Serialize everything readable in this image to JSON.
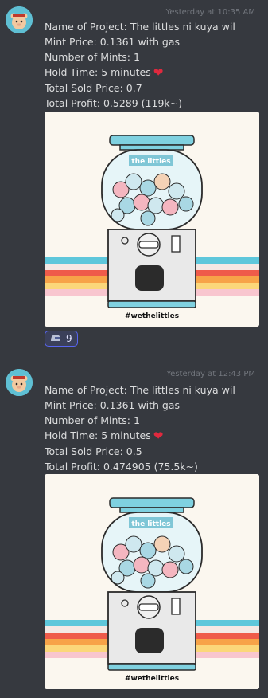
{
  "colors": {
    "background": "#36393f",
    "text": "#dcddde",
    "timestamp": "#72767d",
    "heart": "#e0293e",
    "reaction_border": "#5865f2"
  },
  "messages": [
    {
      "timestamp": "Yesterday at 10:35 AM",
      "lines": {
        "project": "Name of Project: The littles ni kuya wil",
        "mint_price": "Mint Price: 0.1361 with gas",
        "mints": "Number of Mints: 1",
        "hold_time": "Hold Time: 5 minutes",
        "sold_price": "Total Sold Price: 0.7",
        "profit": "Total Profit: 0.5289 (119k~)"
      },
      "image": {
        "title": "the littles",
        "caption": "#wethelittles"
      },
      "reaction": {
        "icon": "helmet-emoji",
        "count": "9"
      }
    },
    {
      "timestamp": "Yesterday at 12:43 PM",
      "lines": {
        "project": "Name of Project: The littles ni kuya wil",
        "mint_price": "Mint Price: 0.1361 with gas",
        "mints": "Number of Mints: 1",
        "hold_time": "Hold Time: 5 minutes",
        "sold_price": "Total Sold Price: 0.5",
        "profit": "Total Profit: 0.474905 (75.5k~)"
      },
      "image": {
        "title": "the littles",
        "caption": "#wethelittles"
      }
    }
  ]
}
